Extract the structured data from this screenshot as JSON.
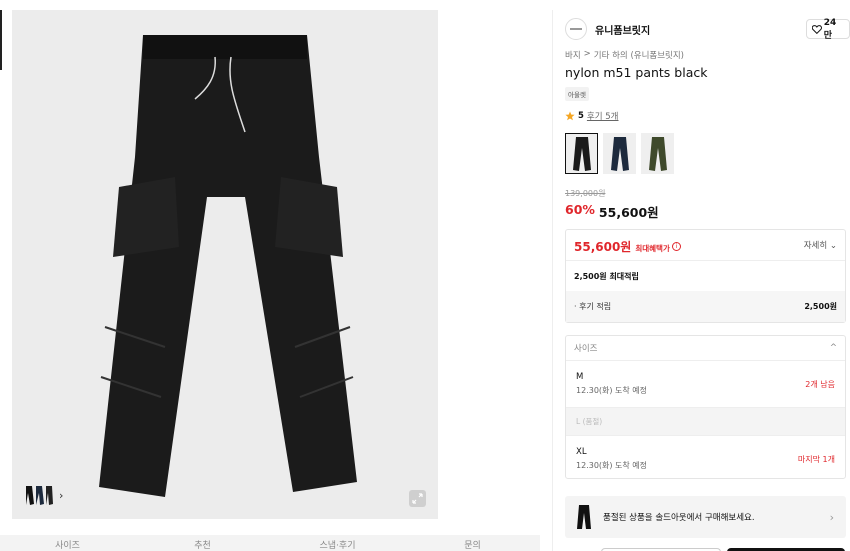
{
  "brand": {
    "name": "유니폼브릿지",
    "like_count": "24만"
  },
  "breadcrumb": [
    "바지",
    ">",
    "기타 하의 (유니폼브릿지)"
  ],
  "product": {
    "title": "nylon m51 pants black",
    "badge": "아울렛",
    "rating": "5",
    "review_link": "후기 5개",
    "original_price": "139,000원",
    "discount": "60%",
    "price": "55,600원"
  },
  "color_options": [
    {
      "name": "black",
      "color": "#1a1a1a",
      "selected": true
    },
    {
      "name": "navy",
      "color": "#1d2a3d",
      "selected": false
    },
    {
      "name": "khaki",
      "color": "#3f4a2c",
      "selected": false
    }
  ],
  "benefit": {
    "max_price": "55,600원",
    "max_label": "최대혜택가",
    "detail_link": "자세히",
    "points_title": "2,500원 최대적립",
    "review_points_label": "· 후기 적립",
    "review_points_value": "2,500원"
  },
  "size": {
    "header": "사이즈",
    "options": [
      {
        "name": "M",
        "eta": "12.30(화) 도착 예정",
        "stock": "2개 남음"
      },
      {
        "name": "L (품절)",
        "soldout": true
      },
      {
        "name": "XL",
        "eta": "12.30(화) 도착 예정",
        "stock": "마지막 1개"
      }
    ]
  },
  "soldout_banner": "품절된 상품을 솔드아웃에서 구매해보세요.",
  "tabs": [
    "사이즈",
    "추천",
    "스냅·후기",
    "문의"
  ],
  "colors": {
    "accent_red": "#e0272c",
    "star": "#f5a623"
  }
}
